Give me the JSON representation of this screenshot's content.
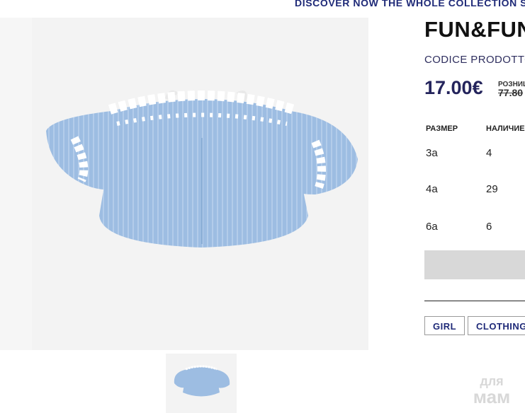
{
  "promo_banner": "DISCOVER NOW THE WHOLE COLLECTION SP",
  "product": {
    "brand": "FUN&FUN",
    "sku_label": "CODICE PRODOTTO",
    "price": "17.00€",
    "retail_label": "РОЗНИЦА",
    "retail_price": "77.80",
    "image_icon": "blouse-image"
  },
  "stock_table": {
    "headers": [
      "РАЗМЕР",
      "НАЛИЧИЕ"
    ],
    "rows": [
      {
        "size": "3a",
        "qty": "4"
      },
      {
        "size": "4a",
        "qty": "29"
      },
      {
        "size": "6a",
        "qty": "6"
      }
    ]
  },
  "tags": [
    "GIRL",
    "CLOTHING"
  ],
  "watermark": {
    "line1": "для",
    "line2": "мам"
  },
  "colors": {
    "accent": "#24245c",
    "promo": "#1f2a78",
    "button": "#d8d8d8",
    "blouse": "#9dbde2"
  }
}
